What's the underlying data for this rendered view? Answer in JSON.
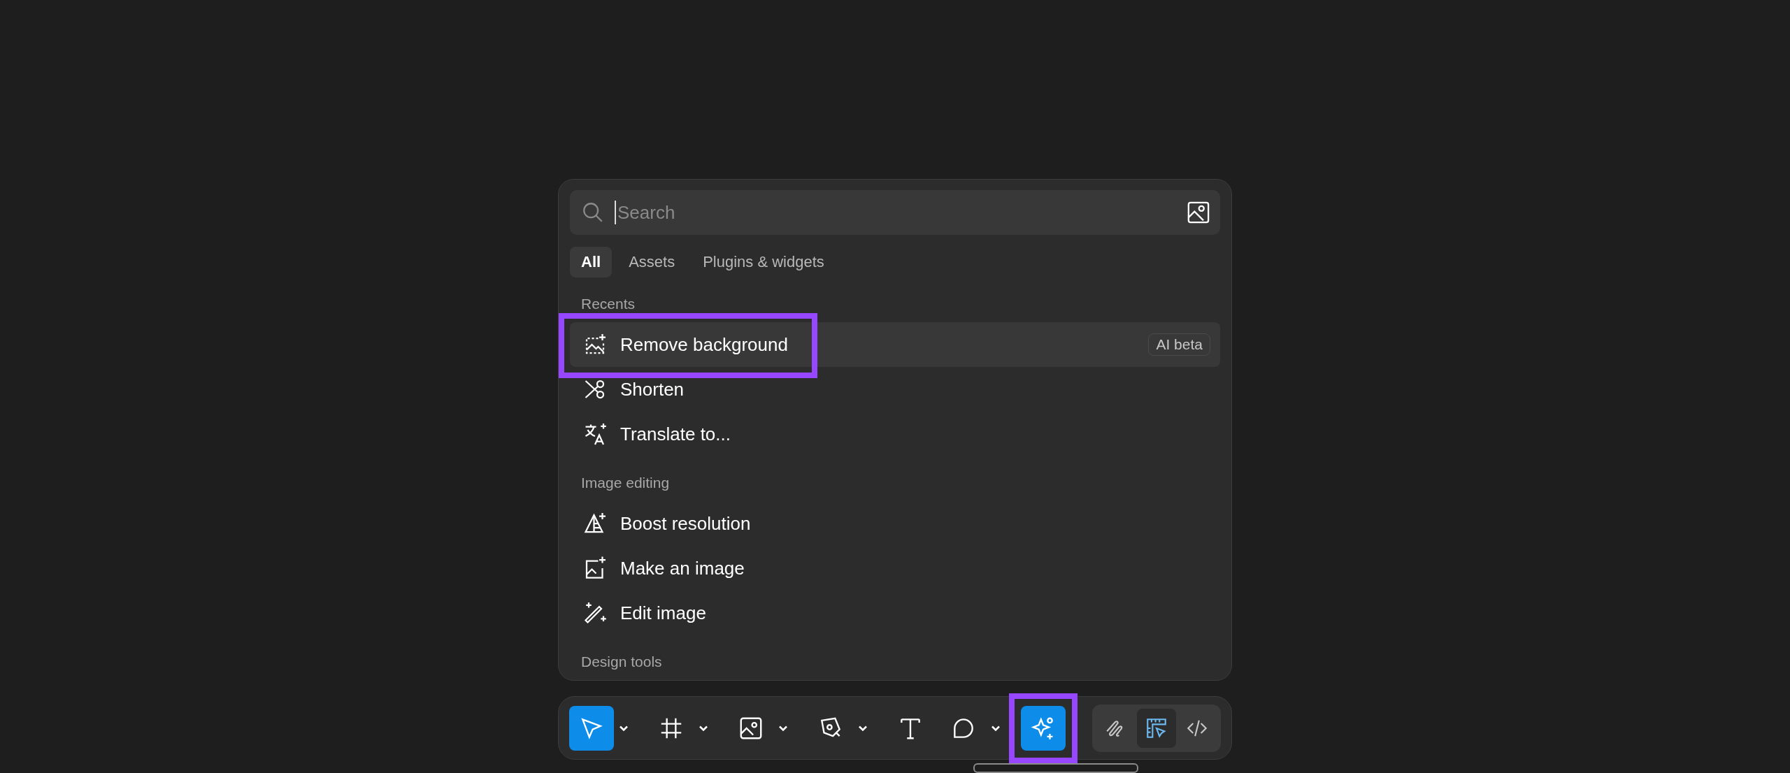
{
  "search": {
    "placeholder": "Search"
  },
  "tabs": [
    {
      "label": "All",
      "selected": true
    },
    {
      "label": "Assets",
      "selected": false
    },
    {
      "label": "Plugins & widgets",
      "selected": false
    }
  ],
  "sections": [
    {
      "title": "Recents",
      "items": [
        {
          "label": "Remove background",
          "selected": true,
          "highlighted": true,
          "badge": "AI beta"
        },
        {
          "label": "Shorten",
          "selected": false,
          "highlighted": false
        },
        {
          "label": "Translate to...",
          "selected": false,
          "highlighted": false
        }
      ]
    },
    {
      "title": "Image editing",
      "items": [
        {
          "label": "Boost resolution",
          "selected": false,
          "highlighted": false
        },
        {
          "label": "Make an image",
          "selected": false,
          "highlighted": false
        },
        {
          "label": "Edit image",
          "selected": false,
          "highlighted": false
        }
      ]
    },
    {
      "title": "Design tools"
    }
  ],
  "toolbar": {
    "tools": [
      {
        "kind": "move",
        "selected": true,
        "highlighted": false,
        "menu": true
      },
      {
        "kind": "frame",
        "selected": false,
        "highlighted": false,
        "menu": true
      },
      {
        "kind": "image",
        "selected": false,
        "highlighted": false,
        "menu": true
      },
      {
        "kind": "pen",
        "selected": false,
        "highlighted": false,
        "menu": true
      },
      {
        "kind": "text",
        "selected": false,
        "highlighted": false,
        "menu": false
      },
      {
        "kind": "comment",
        "selected": false,
        "highlighted": false,
        "menu": true
      },
      {
        "kind": "ai",
        "selected": true,
        "highlighted": true,
        "menu": false
      }
    ],
    "modes": [
      {
        "kind": "draw",
        "selected": false
      },
      {
        "kind": "design",
        "selected": true
      },
      {
        "kind": "dev",
        "selected": false
      }
    ]
  }
}
